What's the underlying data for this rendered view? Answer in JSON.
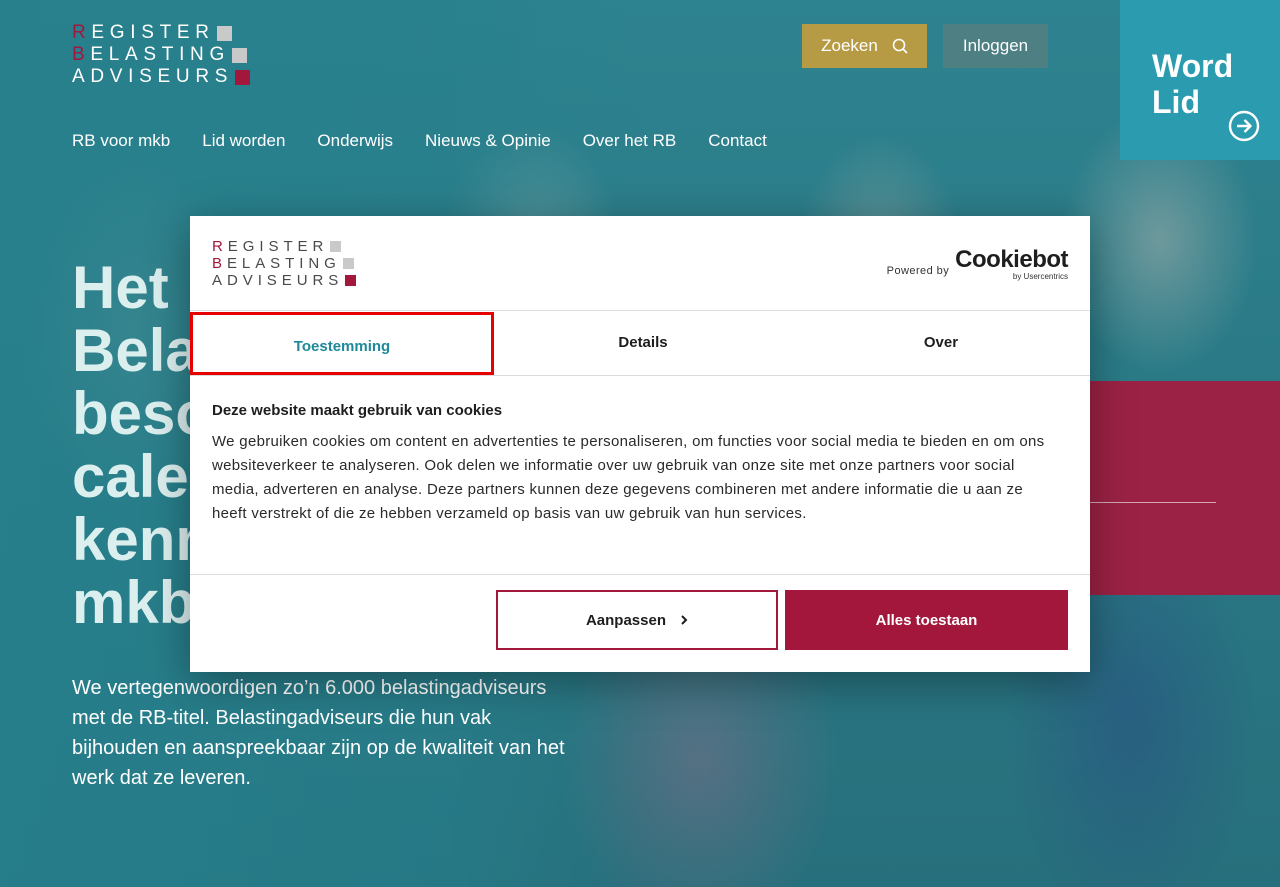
{
  "site": {
    "logo": {
      "lines": [
        {
          "first": "R",
          "rest": "egister"
        },
        {
          "first": "B",
          "rest": "elasting"
        },
        {
          "first": "",
          "rest": "Adviseurs"
        }
      ],
      "squares": [
        "#c9c9c9",
        "#c9c9c9",
        "#a3173d"
      ]
    },
    "search_label": "Zoeken",
    "login_label": "Inloggen",
    "join": {
      "line1": "Word",
      "line2": "Lid"
    },
    "nav": [
      "RB voor mkb",
      "Lid worden",
      "Onderwijs",
      "Nieuws & Opinie",
      "Over het RB",
      "Contact"
    ],
    "hero": {
      "title": "Het\nBela\nbeso\ncale\nkenn\nmkb",
      "body": "We vertegenwoordigen zo’n 6.000 belastingadviseurs met de RB-titel. Belastingadviseurs die hun vak bijhouden en aanspreekbaar zijn op de kwaliteit van het werk dat ze leveren."
    }
  },
  "cookie_dialog": {
    "powered_by": "Powered by",
    "brand": "Cookiebot",
    "brand_sub": "by Usercentrics",
    "tabs": [
      "Toestemming",
      "Details",
      "Over"
    ],
    "active_tab": "Toestemming",
    "heading": "Deze website maakt gebruik van cookies",
    "text": "We gebruiken cookies om content en advertenties te personaliseren, om functies voor social media te bieden en om ons websiteverkeer te analyseren. Ook delen we informatie over uw gebruik van onze site met onze partners voor social media, adverteren en analyse. Deze partners kunnen deze gegevens combineren met andere informatie die u aan ze heeft verstrekt of die ze hebben verzameld op basis van uw gebruik van hun services.",
    "customize_label": "Aanpassen",
    "allow_all_label": "Alles toestaan"
  },
  "colors": {
    "brand_red": "#a3173d",
    "teal": "#2b9cb0",
    "gold": "#b79a44",
    "active_tab_text": "#1e8a99",
    "focus_outline": "#e60000"
  },
  "icons": {
    "search": "search-icon",
    "join_arrow": "arrow-circle-right-icon",
    "customize_chevron": "chevron-right-icon"
  }
}
